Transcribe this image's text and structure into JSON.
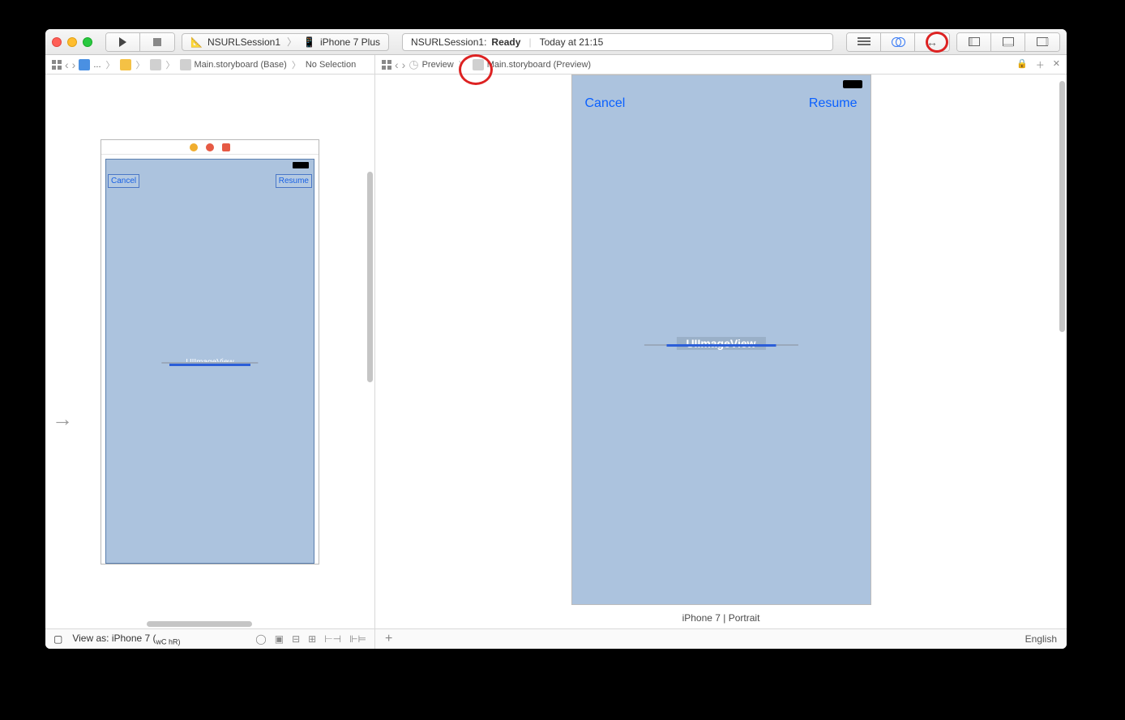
{
  "titlebar": {
    "scheme_app": "NSURLSession1",
    "scheme_device": "iPhone 7 Plus",
    "status_app": "NSURLSession1:",
    "status_state": "Ready",
    "status_time": "Today at 21:15"
  },
  "jumpbar_left": {
    "file": "Main.storyboard (Base)",
    "selection": "No Selection",
    "ellipsis": "..."
  },
  "jumpbar_right": {
    "mode": "Preview",
    "file": "Main.storyboard (Preview)"
  },
  "scene": {
    "btn_cancel": "Cancel",
    "btn_resume": "Resume",
    "imageview": "UIImageView"
  },
  "preview": {
    "btn_cancel": "Cancel",
    "btn_resume": "Resume",
    "imageview": "UIImageView",
    "device_label": "iPhone 7 | Portrait"
  },
  "bottombar": {
    "view_as": "View as: iPhone 7 (",
    "wc": "wC",
    "hr": " hR)",
    "plus": "+",
    "language": "English"
  }
}
